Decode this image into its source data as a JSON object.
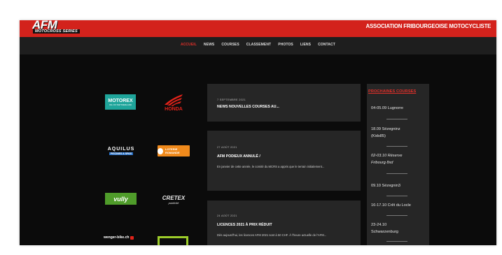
{
  "header": {
    "logo_main": "AFM",
    "logo_sub": "MOTOCROSS SERIES",
    "association": "ASSOCIATION FRIBOURGEOISE MOTOCYCLISTE"
  },
  "nav": {
    "items": [
      "ACCUEIL",
      "NEWS",
      "COURSES",
      "CLASSEMENT",
      "PHOTOS",
      "LIENS",
      "CONTACT"
    ],
    "active": "ACCUEIL"
  },
  "sponsors": {
    "motorex": "MOTOREX",
    "motorex_tag": "OIL OF SWITZERLAND",
    "honda": "HONDA",
    "aquilus": "AQUILUS",
    "aquilus_tag": "PISCINES & SPAS",
    "loterie": "LOTERIE ROMANDE",
    "vully": "vully",
    "cretex": "CRETEX",
    "cretex_tag": "publicité",
    "wenger": "wenger-bike.ch"
  },
  "news": [
    {
      "date": "7 SEPTEMBRE 2021",
      "title": "NEWS NOUVELLES COURSES AU...",
      "excerpt": ""
    },
    {
      "date": "27 AOÛT 2021",
      "title": "AFM PODIEUX ANNULÉ /",
      "excerpt": "En janvier de cette année, le comité du MCRS a appris que le terrain initialement..."
    },
    {
      "date": "24 AOÛT 2021",
      "title": "LICENCES 2021 À PRIX RÉDUIT",
      "excerpt": "Dès aujourd'hui, les licences AFM 2021 sont à 50 CHF. À l'heure actuelle de l'AFM..."
    }
  ],
  "sidebar": {
    "title": "PROCHAINES COURSES",
    "races": [
      {
        "text": "04-05.09 Lugnorre",
        "italic": false
      },
      {
        "text": "18.09 Sézegninz (Kids85)",
        "italic": false
      },
      {
        "text": "02-03.10 Réserve Fribourg 8xd",
        "italic": true
      },
      {
        "text": "09.10 Sézegnin3",
        "italic": false
      },
      {
        "text": "16-17.10 Crêt du Locle",
        "italic": false
      },
      {
        "text": "23-24.10 Schwarzenburg",
        "italic": false
      }
    ]
  },
  "colors": {
    "brand_red": "#d3221c",
    "nav_bg": "#1e1e1e",
    "page_bg": "#0b0b0b",
    "card_bg": "#262626"
  }
}
